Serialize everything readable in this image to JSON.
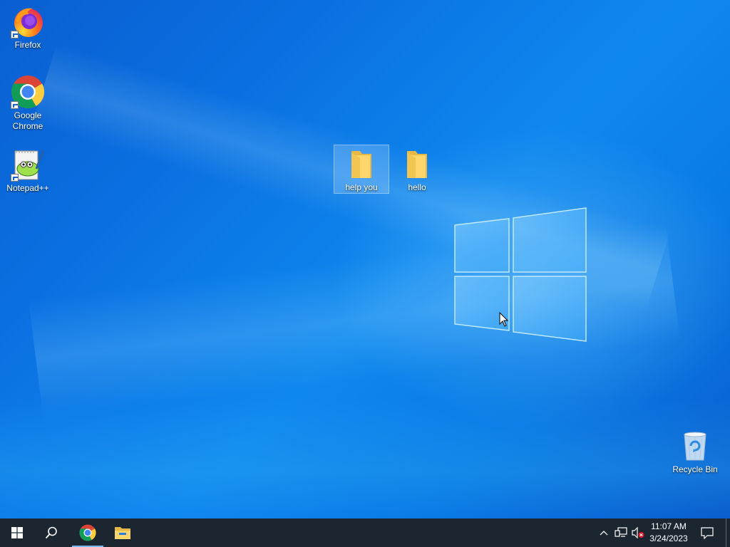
{
  "desktop": {
    "icons": [
      {
        "label": "Firefox"
      },
      {
        "label": "Google Chrome"
      },
      {
        "label": "Notepad++"
      },
      {
        "label": "help you"
      },
      {
        "label": "hello"
      },
      {
        "label": "Recycle Bin"
      }
    ]
  },
  "taskbar": {
    "start_icon": "windows-logo-icon",
    "search_icon": "search-icon",
    "pinned": [
      {
        "name": "Google Chrome",
        "icon": "chrome-icon",
        "active": true
      },
      {
        "name": "File Explorer",
        "icon": "file-explorer-icon",
        "active": false
      }
    ],
    "tray": {
      "icons": [
        "chevron-up-icon",
        "network-icon",
        "volume-muted-icon"
      ],
      "time": "11:07 AM",
      "date": "3/24/2023",
      "notification_icon": "action-center-icon"
    }
  },
  "colors": {
    "desktop_blue": "#0a6fe0",
    "taskbar": "#1b2631",
    "active_indicator": "#76b9ed"
  }
}
